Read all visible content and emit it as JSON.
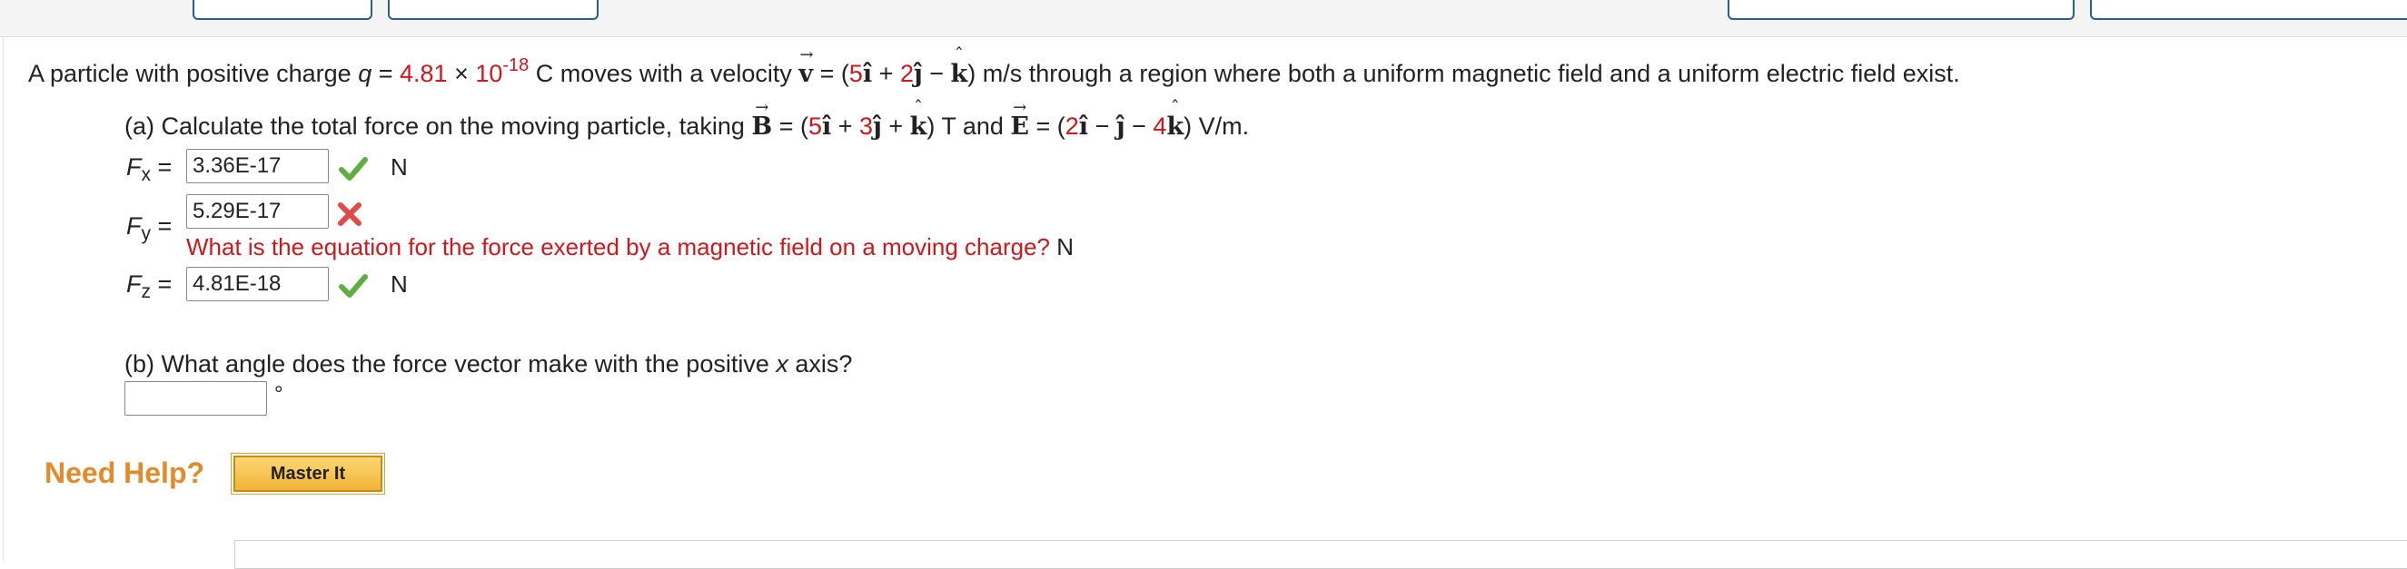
{
  "problem": {
    "intro_pre": "A particle with positive charge ",
    "q_sym": "q",
    "eq": " = ",
    "q_mant": "4.81",
    "times": " × ",
    "q_base": "10",
    "q_exp": "-18",
    "q_unit": " C moves with a velocity ",
    "v_letter": "v",
    "v_open": " = (",
    "v_c1": "5",
    "v_plus1": " + ",
    "v_c2": "2",
    "v_minus": " − ",
    "v_close": ") m/s through a region where both a uniform magnetic field and a uniform electric field exist."
  },
  "part_a": {
    "text_pre": "(a) Calculate the total force on the moving particle, taking ",
    "B_letter": "B",
    "B_open": " = (",
    "B_c1": "5",
    "B_plus1": " + ",
    "B_c2": "3",
    "B_plus2": " + ",
    "B_close": ") T and ",
    "E_letter": "E",
    "E_open": " = (",
    "E_c1": "2",
    "E_minus1": " − ",
    "E_minus2": " − ",
    "E_c3": "4",
    "E_close": ") V/m.",
    "unit_i": "î",
    "unit_j": "ĵ",
    "unit_k": "k",
    "fx_sym": "F",
    "fx_sub": "x",
    "fy_sym": "F",
    "fy_sub": "y",
    "fz_sym": "F",
    "fz_sub": "z",
    "equals": "=",
    "fx_value": "3.36E-17",
    "fy_value": "5.29E-17",
    "fz_value": "4.81E-18",
    "unit_N": "N",
    "fy_hint": "What is the equation for the force exerted by a magnetic field on a moving charge?",
    "fy_hint_unit": " N"
  },
  "part_b": {
    "question_pre": "(b) What angle does the force vector make with the positive ",
    "axis": "x",
    "question_post": " axis?",
    "answer_value": "",
    "unit_deg": "°"
  },
  "help": {
    "need_help_label": "Need Help?",
    "master_it_label": "Master It"
  },
  "colors": {
    "accent_red": "#d0171b",
    "correct_green": "#5fae3e",
    "need_help_orange": "#e38a2b",
    "button_gold": "#f2b437",
    "top_button_border": "#2d5c8f"
  },
  "status": {
    "fx_icon": "check-icon",
    "fy_icon": "cross-icon",
    "fz_icon": "check-icon"
  }
}
